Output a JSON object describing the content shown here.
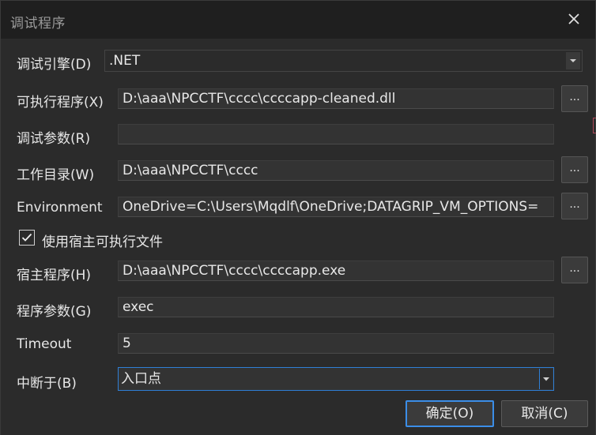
{
  "window": {
    "title": "调试程序"
  },
  "fields": {
    "debug_engine": {
      "label": "调试引擎(D)",
      "value": ".NET"
    },
    "executable": {
      "label": "可执行程序(X)",
      "value": "D:\\aaa\\NPCCTF\\cccc\\ccccapp-cleaned.dll",
      "browse_label": "..."
    },
    "debug_args": {
      "label": "调试参数(R)",
      "value": ""
    },
    "working_dir": {
      "label": "工作目录(W)",
      "value": "D:\\aaa\\NPCCTF\\cccc",
      "browse_label": "..."
    },
    "environment": {
      "label": "Environment",
      "value": "OneDrive=C:\\Users\\Mqdlf\\OneDrive;DATAGRIP_VM_OPTIONS=",
      "browse_label": "..."
    },
    "use_host": {
      "label": "使用宿主可执行文件",
      "checked": true
    },
    "host_program": {
      "label": "宿主程序(H)",
      "value": "D:\\aaa\\NPCCTF\\cccc\\ccccapp.exe",
      "browse_label": "..."
    },
    "program_args": {
      "label": "程序参数(G)",
      "value": "exec"
    },
    "timeout": {
      "label": "Timeout",
      "value": "5"
    },
    "break_at": {
      "label": "中断于(B)",
      "value": "入口点"
    }
  },
  "buttons": {
    "ok": "确定(O)",
    "cancel": "取消(C)"
  },
  "colors": {
    "accent": "#3b8ee8",
    "background": "#2b2b2b",
    "titlebar": "#1f1f1f"
  }
}
